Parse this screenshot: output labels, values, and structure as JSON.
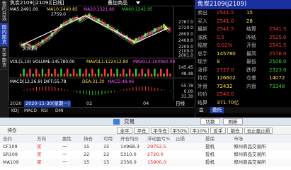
{
  "chart": {
    "title": "焦炭2109(j2109)[日线]",
    "menu": "叠加商品",
    "ind_main": {
      "ma5": "MA5:2491.00",
      "ma10": "MA10:2440.85",
      "ma20": "MA20:2321.80",
      "ma60": "MA60:2242.95"
    },
    "vol": {
      "vol": "VOL(5,10) VOLUME:145780.00",
      "mavol1": "MAVOL1:122412.80",
      "mavol2": "MAVOL2:100960.00"
    },
    "macd": {
      "macd": "MACD(12,26,9) DIFF:55.78",
      "dea": "DEA:31.30",
      "m": "MACD:48.96"
    },
    "price_labels": [
      "2767.0",
      "2720.0",
      "2600.0",
      "2400.0",
      "2200.0",
      "2100.0",
      "2001.0",
      "1800.0"
    ],
    "peak": "2759.0",
    "low": "2051.5",
    "vol_labels": [
      "145.45",
      "48.48"
    ],
    "macd_labels": [
      "55.78",
      "0.00",
      "31.30"
    ],
    "x_labels": {
      "year": "2020",
      "date": "2020-11-30(星期一)",
      "m1": "02",
      "m2": "04",
      "period": "日线"
    },
    "tabs": [
      "KDJ",
      "MACD",
      "RSI",
      "DMI"
    ]
  },
  "sidebar": {
    "tabs": [
      "我的自选",
      "国内期货",
      "天字期货"
    ]
  },
  "quote": {
    "title": "焦炭2109(j2109)",
    "rows": [
      {
        "l": "卖出",
        "v": "2541.5",
        "v2": "15"
      },
      {
        "l": "买入",
        "v": "2541.0",
        "v2": "28"
      },
      {
        "l": "最新",
        "v": "2541.5",
        "l2": "结算",
        "v3": "2541.5"
      },
      {
        "l": "涨跌",
        "v": "0.5",
        "l2": "昨结",
        "v3": "2525.0"
      },
      {
        "l": "幅度",
        "v": "0.02%",
        "l2": "开盘",
        "v3": "2541.5"
      },
      {
        "l": "总手",
        "v": "145780",
        "l2": "最高",
        "v3": "2576.0"
      },
      {
        "l": "现手",
        "v": "8",
        "l2": "最低",
        "v3": "2506.0"
      },
      {
        "l": "涨停",
        "v": "2727.0",
        "l2": "跌停",
        "v3": "2323.0"
      },
      {
        "l": "持仓",
        "v": "126602",
        "l2": "仓差",
        "v3": "14072"
      },
      {
        "l": "外盘",
        "v": "72432",
        "l2": "内盘",
        "v3": "73348"
      },
      {
        "l": "均价",
        "v": "2540.0",
        "l2": "",
        "v3": ""
      }
    ],
    "amount_label": "结算",
    "amount": "371.70亿",
    "tabs": [
      "盘",
      "委托"
    ]
  },
  "trade": {
    "title": "交易",
    "tab": "持仓",
    "buttons": [
      "全平",
      "平仓",
      "平今仓",
      "平50%",
      "平10%",
      "反手",
      "锁仓",
      "云止盈止损"
    ],
    "toolbar_right": [
      "切换",
      "刷新"
    ],
    "headers": [
      "合约",
      "方向",
      "属性",
      "持仓",
      "可用",
      "开仓均价",
      "浮动盈亏%",
      "止损",
      "投保",
      "市场"
    ],
    "rows": [
      [
        "CF109",
        "买",
        "一",
        "15",
        "15",
        "14968.3",
        "29752.5",
        "",
        "投机",
        "郑州商品交易所"
      ],
      [
        "SR109",
        "买",
        "一",
        "22",
        "22",
        "5310.0",
        "2720.0",
        "",
        "投机",
        "郑州商品交易所"
      ],
      [
        "MA109",
        "买",
        "一",
        "15",
        "15",
        "2356.0",
        "15900.0",
        "",
        "投机",
        "郑州商品交易所"
      ]
    ]
  }
}
